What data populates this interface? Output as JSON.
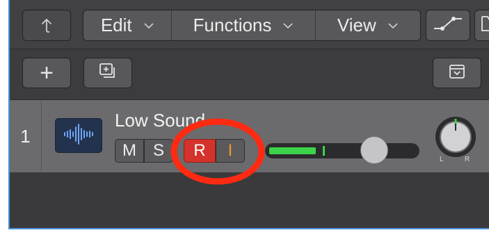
{
  "toolbar": {
    "back_icon": "back-arrow-icon",
    "menus": [
      {
        "label": "Edit"
      },
      {
        "label": "Functions"
      },
      {
        "label": "View"
      }
    ],
    "automation_icon": "automation-curve-icon",
    "partial_icon": "catch-icon"
  },
  "actions": {
    "add_label": "+",
    "duplicate_icon": "duplicate-track-icon",
    "collapse_icon": "collapse-icon"
  },
  "track": {
    "number": "1",
    "name": "Low Sound",
    "icon": "audio-waveform-icon",
    "mute_label": "M",
    "solo_label": "S",
    "record_label": "R",
    "input_monitor_label": "I",
    "record_enabled": true,
    "meter_level": 0.32,
    "volume_fader": 0.72,
    "pan_left_label": "L",
    "pan_right_label": "R"
  },
  "colors": {
    "record_active": "#d4322c",
    "input_monitor": "#f09a2a",
    "meter": "#3bd34a",
    "annotation": "#ff2a12"
  }
}
